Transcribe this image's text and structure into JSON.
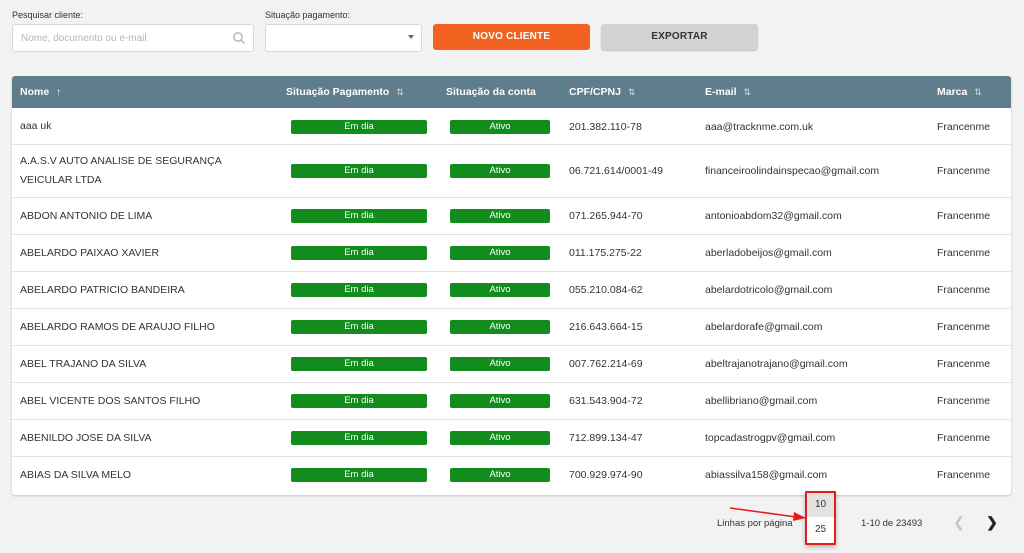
{
  "filters": {
    "search_label": "Pesquisar cliente:",
    "search_placeholder": "Nome, documento ou e-mail",
    "payment_label": "Situação pagamento:",
    "payment_value": "",
    "new_client_button": "NOVO CLIENTE",
    "export_button": "EXPORTAR"
  },
  "table": {
    "columns": {
      "name": "Nome",
      "payment": "Situação Pagamento",
      "account": "Situação da conta",
      "cpf": "CPF/CPNJ",
      "email": "E-mail",
      "brand": "Marca"
    },
    "rows": [
      {
        "name": "aaa uk",
        "payment": "Em dia",
        "account": "Ativo",
        "cpf": "201.382.110-78",
        "email": "aaa@tracknme.com.uk",
        "brand": "Francenme"
      },
      {
        "name": "A.A.S.V AUTO ANALISE DE SEGURANÇA VEICULAR LTDA",
        "payment": "Em dia",
        "account": "Ativo",
        "cpf": "06.721.614/0001-49",
        "email": "financeiroolindainspecao@gmail.com",
        "brand": "Francenme"
      },
      {
        "name": "ABDON ANTONIO DE LIMA",
        "payment": "Em dia",
        "account": "Ativo",
        "cpf": "071.265.944-70",
        "email": "antonioabdom32@gmail.com",
        "brand": "Francenme"
      },
      {
        "name": "ABELARDO PAIXAO XAVIER",
        "payment": "Em dia",
        "account": "Ativo",
        "cpf": "011.175.275-22",
        "email": "aberladobeijos@gmail.com",
        "brand": "Francenme"
      },
      {
        "name": "ABELARDO PATRICIO BANDEIRA",
        "payment": "Em dia",
        "account": "Ativo",
        "cpf": "055.210.084-62",
        "email": "abelardotricolo@gmail.com",
        "brand": "Francenme"
      },
      {
        "name": "ABELARDO RAMOS DE ARAUJO FILHO",
        "payment": "Em dia",
        "account": "Ativo",
        "cpf": "216.643.664-15",
        "email": "abelardorafe@gmail.com",
        "brand": "Francenme"
      },
      {
        "name": "ABEL TRAJANO DA SILVA",
        "payment": "Em dia",
        "account": "Ativo",
        "cpf": "007.762.214-69",
        "email": "abeltrajanotrajano@gmail.com",
        "brand": "Francenme"
      },
      {
        "name": "ABEL VICENTE DOS SANTOS FILHO",
        "payment": "Em dia",
        "account": "Ativo",
        "cpf": "631.543.904-72",
        "email": "abellibriano@gmail.com",
        "brand": "Francenme"
      },
      {
        "name": "ABENILDO JOSE DA SILVA",
        "payment": "Em dia",
        "account": "Ativo",
        "cpf": "712.899.134-47",
        "email": "topcadastrogpv@gmail.com",
        "brand": "Francenme"
      },
      {
        "name": "ABIAS DA SILVA MELO",
        "payment": "Em dia",
        "account": "Ativo",
        "cpf": "700.929.974-90",
        "email": "abiassilva158@gmail.com",
        "brand": "Francenme"
      }
    ]
  },
  "pagination": {
    "rows_label": "Linhas por página",
    "options": [
      "10",
      "25"
    ],
    "selected": "10",
    "range": "1-10 de 23493",
    "prev_icon": "chevron-left-icon",
    "next_icon": "chevron-right-icon"
  },
  "colors": {
    "header_bg": "#5f7d8c",
    "primary_button": "#f26322",
    "badge_green": "#118c1d",
    "annotation_red": "#e31c1c"
  }
}
